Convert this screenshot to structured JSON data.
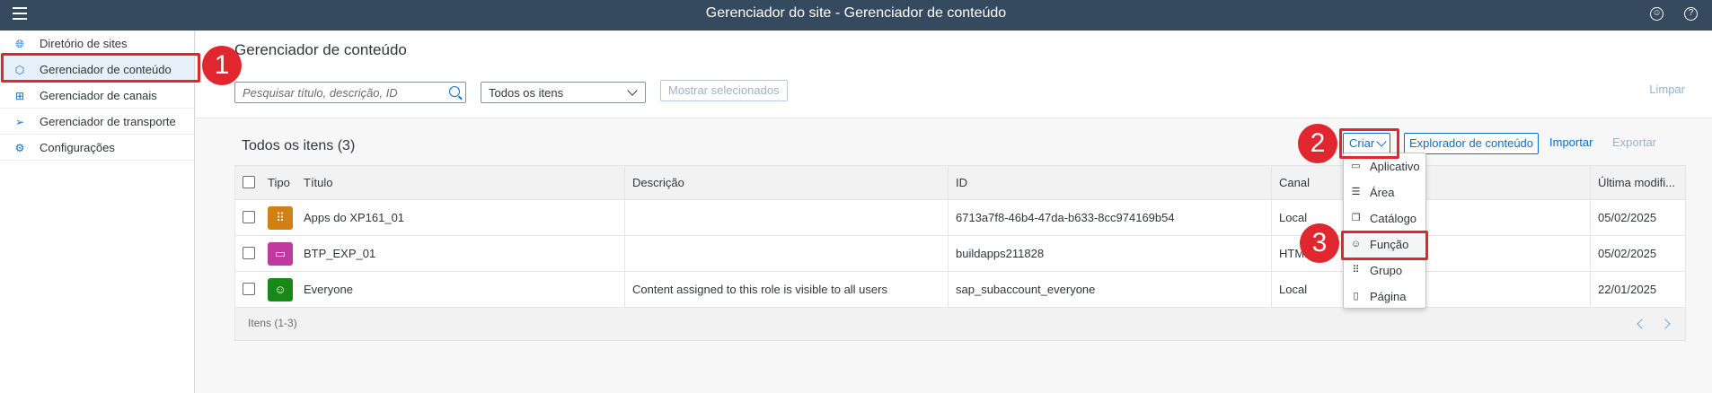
{
  "shell": {
    "title": "Gerenciador do site - Gerenciador de conteúdo",
    "menu_icon": "hamburger-icon",
    "user_icon": "user-icon",
    "help_icon": "help-icon"
  },
  "sidebar": {
    "items": [
      {
        "label": "Diretório de sites",
        "icon": "globe-icon"
      },
      {
        "label": "Gerenciador de conteúdo",
        "icon": "cube-icon",
        "active": true
      },
      {
        "label": "Gerenciador de canais",
        "icon": "hierarchy-icon"
      },
      {
        "label": "Gerenciador de transporte",
        "icon": "paper-plane-icon"
      },
      {
        "label": "Configurações",
        "icon": "gears-icon"
      }
    ]
  },
  "annotations": {
    "step1": "1",
    "step2": "2",
    "step3": "3",
    "color": "#e0262f"
  },
  "header": {
    "title": "Gerenciador de conteúdo",
    "search_placeholder": "Pesquisar título, descrição, ID",
    "filter_value": "Todos os itens",
    "show_selected": "Mostrar selecionados",
    "clear": "Limpar"
  },
  "toolbar": {
    "title": "Todos os itens (3)",
    "create": "Criar",
    "explorer": "Explorador de conteúdo",
    "import": "Importar",
    "export": "Exportar"
  },
  "table": {
    "columns": [
      "Tipo",
      "Título",
      "Descrição",
      "ID",
      "Canal",
      "Última modifi..."
    ],
    "rows": [
      {
        "type_icon": "apps-grid-icon",
        "type_color": "#d08014",
        "title": "Apps do XP161_01",
        "description": "",
        "id": "6713a7f8-46b4-47da-b633-8cc974169b54",
        "channel": "Local",
        "modified": "05/02/2025"
      },
      {
        "type_icon": "window-icon",
        "type_color": "#c0399f",
        "title": "BTP_EXP_01",
        "description": "",
        "id": "buildapps211828",
        "channel": "HTML",
        "modified": "05/02/2025"
      },
      {
        "type_icon": "role-icon",
        "type_color": "#188918",
        "title": "Everyone",
        "description": "Content assigned to this role is visible to all users",
        "id": "sap_subaccount_everyone",
        "channel": "Local",
        "modified": "22/01/2025"
      }
    ],
    "footer": "Itens (1-3)"
  },
  "create_menu": {
    "items": [
      {
        "label": "Aplicativo",
        "icon": "window-icon"
      },
      {
        "label": "Área",
        "icon": "area-icon"
      },
      {
        "label": "Catálogo",
        "icon": "catalog-icon"
      },
      {
        "label": "Função",
        "icon": "role-icon"
      },
      {
        "label": "Grupo",
        "icon": "group-grid-icon"
      },
      {
        "label": "Página",
        "icon": "page-icon"
      }
    ]
  }
}
